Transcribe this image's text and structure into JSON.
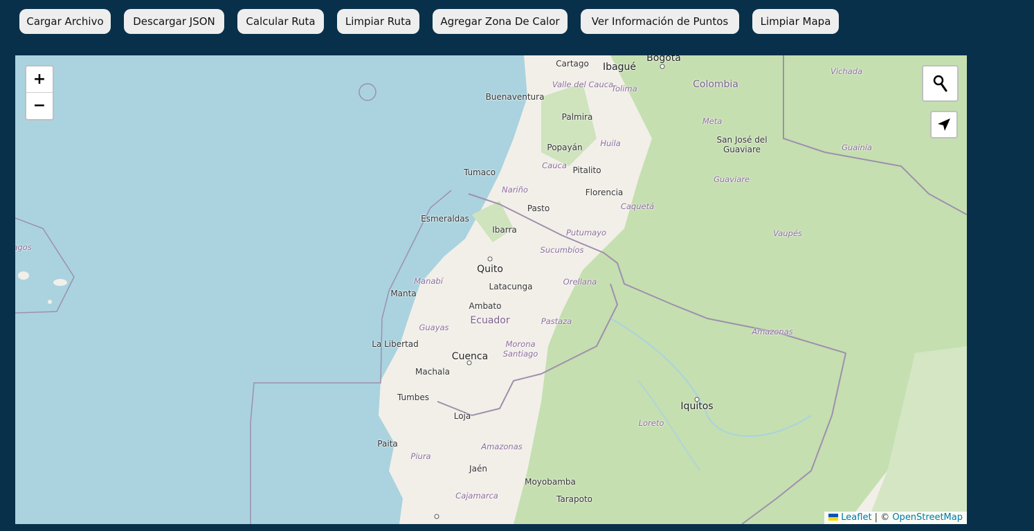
{
  "toolbar": {
    "buttons": [
      {
        "label": "Cargar Archivo"
      },
      {
        "label": "Descargar JSON"
      },
      {
        "label": "Calcular Ruta"
      },
      {
        "label": "Limpiar Ruta"
      },
      {
        "label": "Agregar Zona De Calor"
      },
      {
        "label": "Ver Información de Puntos"
      },
      {
        "label": "Limpiar Mapa"
      }
    ]
  },
  "map": {
    "zoom_in_label": "+",
    "zoom_out_label": "−",
    "search_icon": "search-icon",
    "locate_icon": "location-arrow-icon",
    "labels": {
      "bogota": "Bogota",
      "cartago": "Cartago",
      "ibague": "Ibagué",
      "colombia": "Colombia",
      "vichada": "Vichada",
      "valle_del_cauca": "Valle del Cauca",
      "tolima": "Tolima",
      "buenaventura": "Buenaventura",
      "palmira": "Palmira",
      "meta": "Meta",
      "popayan": "Popayán",
      "huila": "Huila",
      "san_jose": "San José del Guaviare",
      "guainia": "Guainía",
      "cauca": "Cauca",
      "pitalito": "Pitalito",
      "tumaco": "Tumaco",
      "guaviare": "Guaviare",
      "narino": "Nariño",
      "florencia": "Florencia",
      "pasto": "Pasto",
      "caqueta": "Caquetá",
      "esmeraldas": "Esmeraldas",
      "ibarra": "Ibarra",
      "putumayo": "Putumayo",
      "vaupes": "Vaupés",
      "sucumbios": "Sucumbíos",
      "quito": "Quito",
      "manabi": "Manabí",
      "latacunga": "Latacunga",
      "orellana": "Orellana",
      "manta": "Manta",
      "ambato": "Ambato",
      "ecuador": "Ecuador",
      "pastaza": "Pastaza",
      "guayas": "Guayas",
      "amazonas_north": "Amazonas",
      "la_libertad": "La Libertad",
      "morona_santiago": "Morona Santiago",
      "cuenca": "Cuenca",
      "machala": "Machala",
      "tumbes": "Tumbes",
      "iquitos": "Iquitos",
      "loja": "Loja",
      "loreto": "Loreto",
      "paita": "Paita",
      "amazonas_south": "Amazonas",
      "piura": "Piura",
      "jaen": "Jaén",
      "moyobamba": "Moyobamba",
      "cajamarca": "Cajamarca",
      "tarapoto": "Tarapoto",
      "galapagos": "agos"
    },
    "attribution": {
      "leaflet": "Leaflet",
      "separator": " | © ",
      "osm": "OpenStreetMap"
    }
  },
  "colors": {
    "page_background": "#08304a",
    "ocean": "#aad3df",
    "land": "#f2efe9",
    "forest": "#c5dfb0",
    "border": "#9e8fae",
    "link": "#0078a8"
  }
}
